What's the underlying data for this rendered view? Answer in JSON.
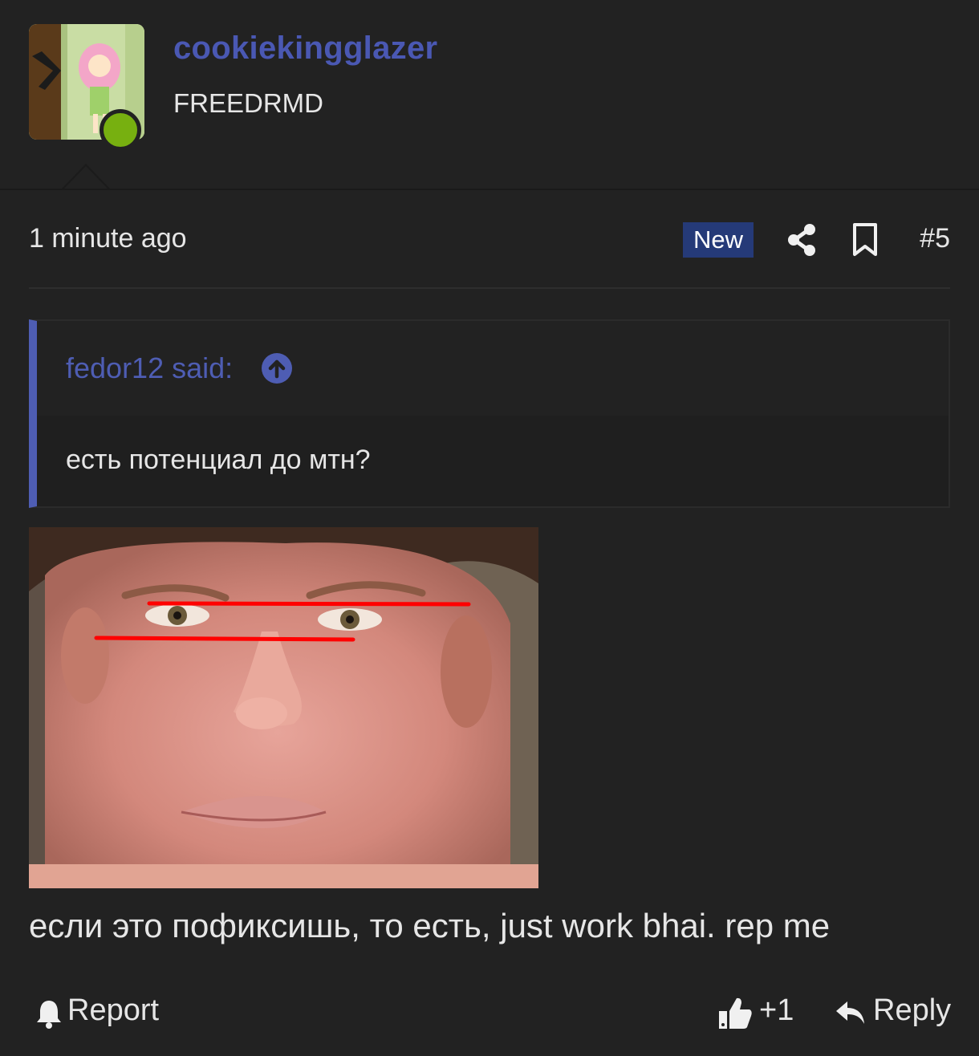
{
  "post": {
    "author": {
      "username": "cookiekingglazer",
      "title": "FREEDRMD",
      "online": true
    },
    "timestamp": "1 minute ago",
    "badge": "New",
    "post_number": "#5",
    "quote": {
      "author_line": "fedor12 said:",
      "text": "есть потенциал до мтн?"
    },
    "image_icon": "photo-of-face-with-red-lines",
    "body": "если это пофиксишь, то есть, just work bhai. rep me",
    "actions": {
      "report_label": "Report",
      "like_label": "+1",
      "reply_label": "Reply"
    }
  },
  "colors": {
    "background": "#222222",
    "username": "#4a58b3",
    "quote_accent": "#4e5db3",
    "badge_bg": "#253a78",
    "online": "#77b010"
  },
  "icons": {
    "share": "share-icon",
    "bookmark": "bookmark-icon",
    "quote_jump": "arrow-up-circle-icon",
    "report": "bell-icon",
    "like": "thumbs-up-icon",
    "reply": "reply-icon"
  }
}
